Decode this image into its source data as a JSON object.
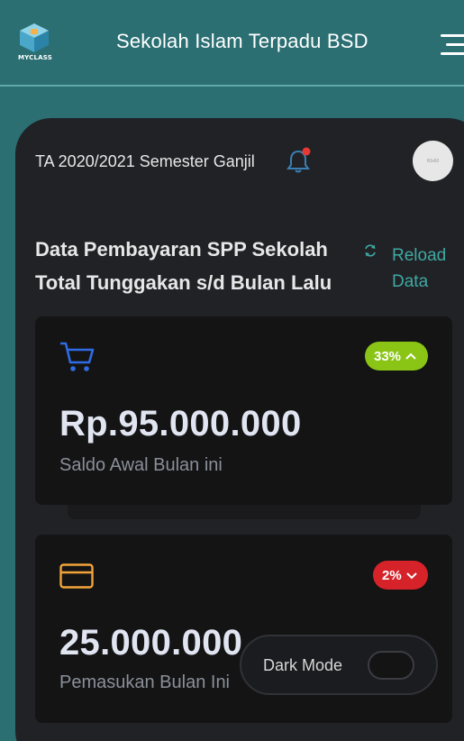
{
  "header": {
    "logo_text": "MYCLASS",
    "title": "Sekolah Islam Terpadu BSD"
  },
  "session": {
    "term": "TA 2020/2021 Semester Ganjil",
    "avatar_text": "60x60"
  },
  "info": {
    "title_line1": "Data Pembayaran SPP Sekolah",
    "title_line2": "Total Tunggakan s/d Bulan Lalu",
    "reload_label": "Reload Data"
  },
  "cards": [
    {
      "icon": "cart-icon",
      "badge": "33%",
      "badge_direction": "up",
      "badge_color": "#8ac516",
      "amount": "Rp.95.000.000",
      "label": "Saldo Awal Bulan ini",
      "icon_color": "#2f6be3"
    },
    {
      "icon": "credit-card-icon",
      "badge": "2%",
      "badge_direction": "down",
      "badge_color": "#d6232a",
      "amount": "25.000.000",
      "label": "Pemasukan Bulan Ini",
      "icon_color": "#f2a33a"
    }
  ],
  "dark_mode": {
    "label": "Dark Mode",
    "enabled": false
  },
  "colors": {
    "header_bg": "#2b6f73",
    "panel_bg": "#212226",
    "card_bg": "#141415",
    "accent": "#3fa9a3",
    "notification_dot": "#e53935"
  }
}
